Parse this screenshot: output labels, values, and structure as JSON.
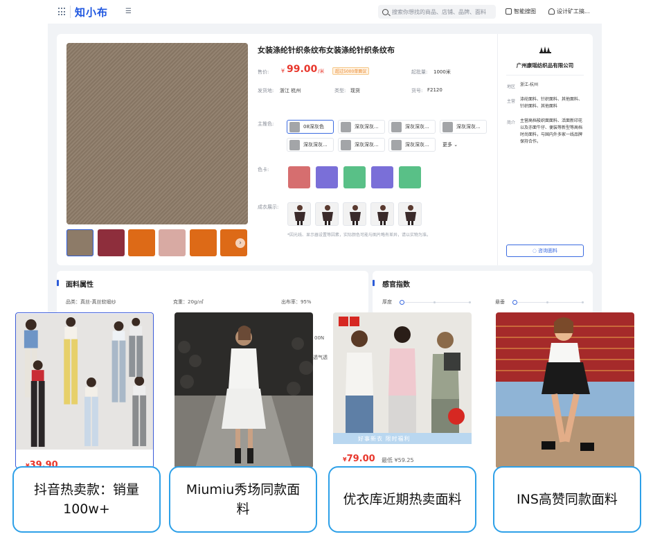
{
  "header": {
    "brand": "知小布",
    "search_placeholder": "搜索你想找的商品、店铺、品牌、面料",
    "smart_search": "智能搜图",
    "user": "设计矿工搞..."
  },
  "product": {
    "title": "女装涤纶针织条纹布女装涤纶针织条纹布",
    "price_label": "售价:",
    "price_currency": "¥",
    "price_value": "99.00",
    "price_unit": "/米",
    "price_badge": "超过5000单面议",
    "moq_label": "起批量:",
    "moq_value": "1000米",
    "origin_label": "发货地:",
    "origin_value": "浙江 杭州",
    "type_label": "类型:",
    "type_value": "现货",
    "sku_label": "货号:",
    "sku_value": "F2120",
    "variants_label": "主推色:",
    "variants": [
      "08深灰色",
      "深灰深灰...",
      "深灰深灰...",
      "深灰深灰...",
      "深灰深灰...",
      "深灰深灰...",
      "深灰深灰..."
    ],
    "more_label": "更多",
    "colorcard_label": "色卡:",
    "color_chips": [
      "#d66e6f",
      "#7a6fd8",
      "#59c087",
      "#7a6fd8",
      "#59c087"
    ],
    "models_label": "成衣展示:",
    "disclaimer": "*因光线、显示器设置等因素，实际颜色可能与图片略有差异，请以实物为准。",
    "thumb_colors": [
      "#8d7b68",
      "#8e2e3c",
      "#dd6a17",
      "#d8aaa3",
      "#dd6a17",
      "#dd6a17"
    ]
  },
  "supplier": {
    "logo_text": "Gmonster",
    "name": "广州康瑶纺织品有限公司",
    "region_label": "地区",
    "region_value": "浙江-杭州",
    "main_label": "主营",
    "main_value": "涤纶面料、针织面料、其他面料、针织面料、其他面料",
    "intro_label": "简介",
    "intro_value": "主营高档梭织面面料、活面新印花以及亦面牛仔、便装等新型等高档时尚面料，与国内外多家一线品牌保持合作。",
    "consult_button": "咨询面料"
  },
  "attributes": {
    "title": "面料属性",
    "category_label": "品类：",
    "category_value": "真丝-真丝软缎纱",
    "weight_label": "克重：",
    "weight_value": "20g/㎡",
    "yield_label": "出布率：",
    "yield_value": "95%",
    "remnant_1": "00N",
    "remnant_2": "透气透"
  },
  "sensory": {
    "title": "感官指数",
    "thickness_label": "厚度",
    "drape_label": "悬垂"
  },
  "trends": [
    {
      "price_currency": "¥",
      "price_value": "39.90",
      "caption": "抖音热卖款：销量100w+"
    },
    {
      "caption": "Miumiu秀场同款面料"
    },
    {
      "price_currency": "¥",
      "price_value": "79.00",
      "sub": "最低 ¥59.25",
      "banner": "好事新衣 限时福利",
      "caption": "优衣库近期热卖面料"
    },
    {
      "caption": "INS高赞同款面料"
    }
  ]
}
